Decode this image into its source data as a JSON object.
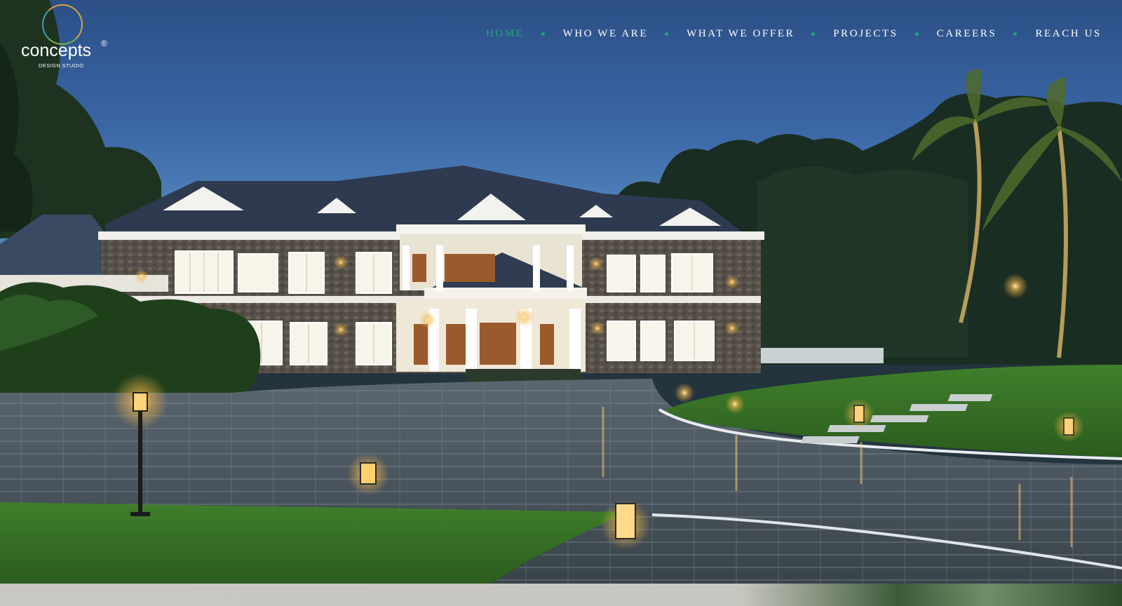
{
  "brand": {
    "logo_word": "concepts",
    "logo_registered": "®",
    "logo_subtitle": "DESIGN STUDIO",
    "ring_colors": [
      "#d6a73a",
      "#3fa0b5",
      "#7cb342"
    ]
  },
  "nav": {
    "items": [
      {
        "label": "HOME",
        "active": true
      },
      {
        "label": "WHO WE ARE",
        "active": false
      },
      {
        "label": "WHAT WE OFFER",
        "active": false
      },
      {
        "label": "PROJECTS",
        "active": false
      },
      {
        "label": "CAREERS",
        "active": false
      },
      {
        "label": "REACH US",
        "active": false
      }
    ],
    "active_color": "#20a77a",
    "text_color": "#ffffff"
  },
  "hero": {
    "image": "evening-villa-driveway-photo"
  }
}
